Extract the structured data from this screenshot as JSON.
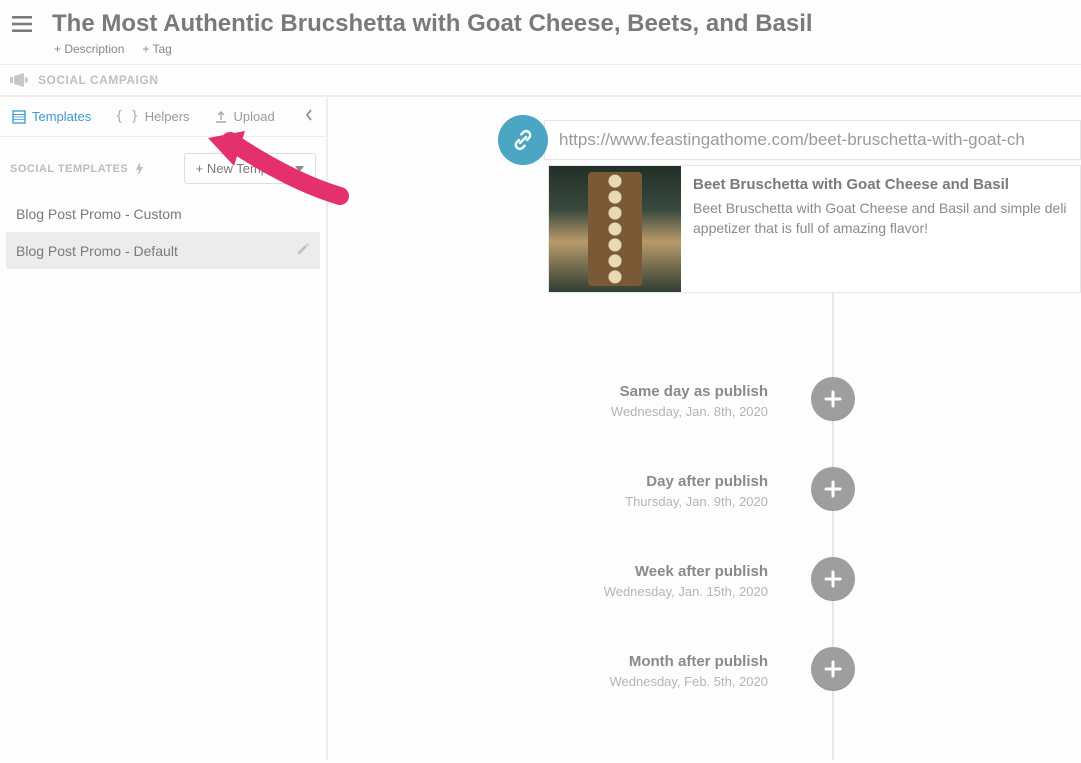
{
  "header": {
    "title": "The Most Authentic Brucshetta with Goat Cheese, Beets, and Basil",
    "add_description": "+ Description",
    "add_tag": "+ Tag"
  },
  "campaign_label": "SOCIAL CAMPAIGN",
  "sidebar": {
    "tabs": {
      "templates": "Templates",
      "helpers": "Helpers",
      "upload": "Upload"
    },
    "section_label": "SOCIAL TEMPLATES",
    "new_template_btn": "+ New Template",
    "templates": [
      {
        "name": "Blog Post Promo - Custom",
        "selected": false
      },
      {
        "name": "Blog Post Promo - Default",
        "selected": true
      }
    ]
  },
  "link": {
    "url": "https://www.feastingathome.com/beet-bruschetta-with-goat-ch",
    "preview_title": "Beet Bruschetta with Goat Cheese and Basil",
    "preview_desc": "Beet Bruschetta with Goat Cheese and Basil and simple deli appetizer that is full of amazing flavor!"
  },
  "milestones": [
    {
      "label": "Same day as publish",
      "date": "Wednesday, Jan. 8th, 2020"
    },
    {
      "label": "Day after publish",
      "date": "Thursday, Jan. 9th, 2020"
    },
    {
      "label": "Week after publish",
      "date": "Wednesday, Jan. 15th, 2020"
    },
    {
      "label": "Month after publish",
      "date": "Wednesday, Feb. 5th, 2020"
    }
  ],
  "colors": {
    "accent": "#4aa6c2",
    "arrow": "#e5306f"
  }
}
